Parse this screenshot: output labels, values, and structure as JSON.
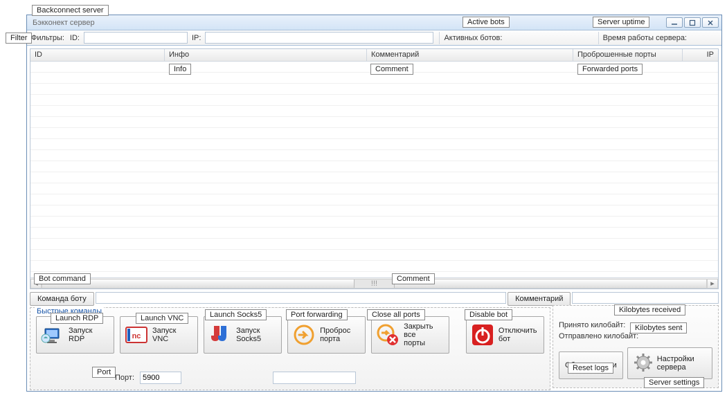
{
  "callouts": {
    "backconnect": "Backconnect server",
    "filter": "Filter",
    "active_bots": "Active bots",
    "server_uptime": "Server uptime",
    "info": "Info",
    "comment_col": "Comment",
    "forwarded_ports": "Forwarded ports",
    "bot_command": "Bot command",
    "comment_field": "Comment",
    "launch_rdp": "Launch RDP",
    "launch_vnc": "Launch VNC",
    "launch_socks5": "Launch Socks5",
    "port_forwarding": "Port forwarding",
    "close_all_ports": "Close all ports",
    "disable_bot": "Disable bot",
    "port": "Port",
    "kb_received": "Kilobytes received",
    "kb_sent": "Kilobytes sent",
    "reset_logs": "Reset logs",
    "server_settings": "Server settings"
  },
  "title": "Бэкконект сервер",
  "filterbar": {
    "label": "Фильтры:",
    "id": "ID:",
    "ip": "IP:",
    "active_bots": "Активных ботов:",
    "uptime": "Время работы сервера:"
  },
  "columns": {
    "id": "ID",
    "info": "Инфо",
    "comment": "Комментарий",
    "ports": "Проброшенные порты",
    "ip": "IP"
  },
  "hscroll_grip": "!!!",
  "botcmd": {
    "button": "Команда боту",
    "comment_button": "Комментарий"
  },
  "quick": {
    "group": "Быстрые команды",
    "rdp": "Запуск\nRDP",
    "vnc": "Запуск\nVNC",
    "socks": "Запуск\nSocks5",
    "fwd": "Проброс\nпорта",
    "close": "Закрыть\nвсе\nпорты",
    "disable": "Отключить\nбот",
    "port_label": "Порт:",
    "port_value": "5900"
  },
  "right": {
    "received": "Принято килобайт:",
    "sent": "Отправлено килобайт:",
    "reset": "Сбросить логи",
    "settings": "Настройки\nсервера"
  }
}
